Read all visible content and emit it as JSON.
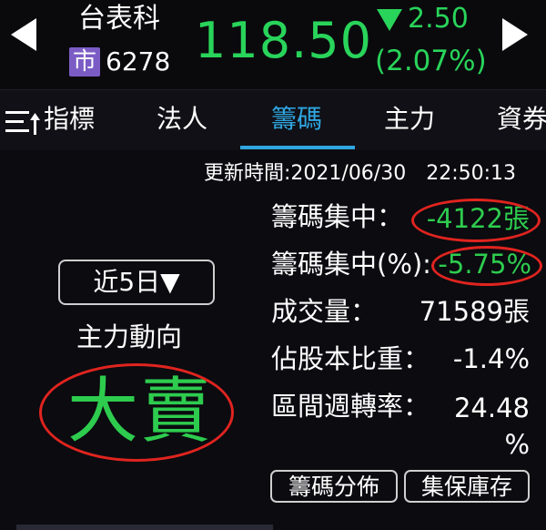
{
  "stock": {
    "name": "台表科",
    "market_badge": "市",
    "code": "6278",
    "price": "118.50",
    "change": "2.50",
    "change_pct": "(2.07%)",
    "colors": {
      "down": "#29d45a",
      "badge": "#7b5cc5"
    }
  },
  "tabs": [
    {
      "label": "指標"
    },
    {
      "label": "法人"
    },
    {
      "label": "籌碼",
      "active": true
    },
    {
      "label": "主力"
    },
    {
      "label": "資券"
    }
  ],
  "content": {
    "updated": "更新時間:2021/06/30　22:50:13",
    "period": "近5日▼",
    "main_force_label": "主力動向",
    "verdict": "大賣",
    "rows": [
      {
        "label": "籌碼集中：",
        "value": "-4122張"
      },
      {
        "label": "籌碼集中(%):",
        "value": "-5.75%"
      },
      {
        "label": "成交量：",
        "value": "71589張"
      },
      {
        "label": "佔股本比重：",
        "value": "-1.4%"
      },
      {
        "label": "區間週轉率：",
        "value": "24.48"
      }
    ],
    "turnover_unit": "%",
    "buttons": {
      "distribution": "籌碼分佈",
      "custody": "集保庫存"
    },
    "highlight_color": "#e0241f",
    "accent_color": "#2fa6e0"
  }
}
